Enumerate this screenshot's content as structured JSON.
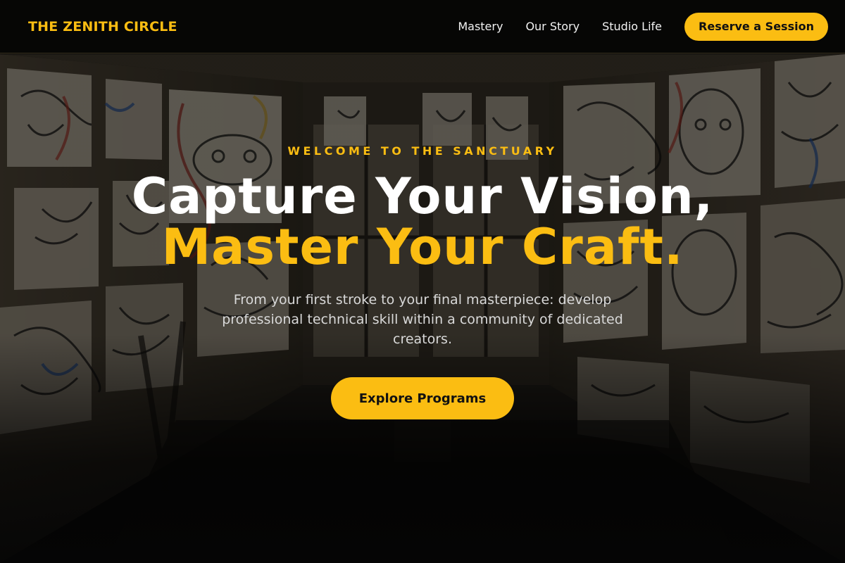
{
  "brand": {
    "name": "THE ZENITH CIRCLE",
    "accent_color": "#fbbd12"
  },
  "nav": {
    "links": [
      "Mastery",
      "Our Story",
      "Studio Life"
    ],
    "cta_label": "Reserve a Session"
  },
  "hero": {
    "eyebrow": "WELCOME TO THE SANCTUARY",
    "headline_line1": "Capture Your Vision,",
    "headline_line2": "Master Your Craft.",
    "subtext": "From your first stroke to your final masterpiece: develop professional technical skill within a community of dedicated creators.",
    "cta_label": "Explore Programs",
    "background_image": "art-studio-room-with-sketches-on-walls"
  }
}
